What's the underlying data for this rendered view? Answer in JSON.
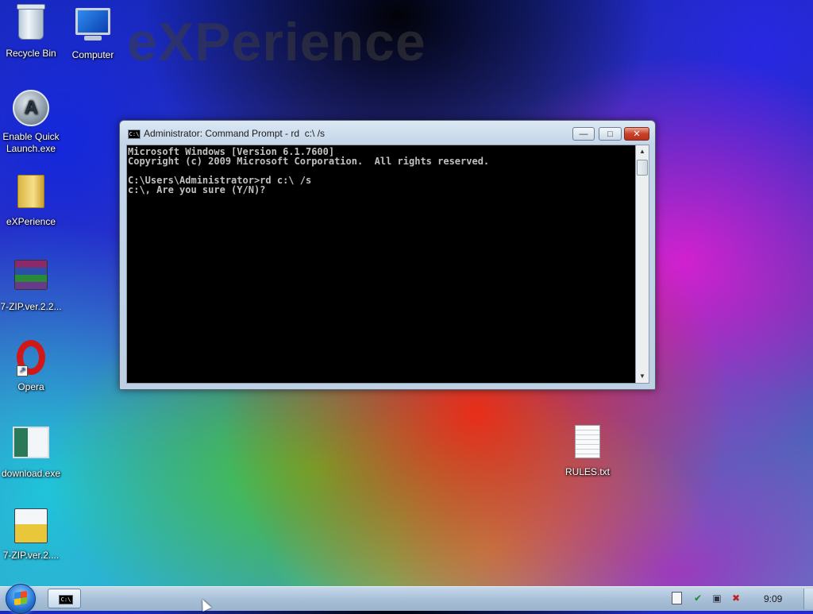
{
  "wallpaper": {
    "watermark": "eXPerience"
  },
  "desktop": {
    "icons": [
      {
        "label": "Recycle Bin",
        "icon": "recycle-bin-icon"
      },
      {
        "label": "Computer",
        "icon": "computer-icon"
      },
      {
        "label": "Enable Quick Launch.exe",
        "icon": "quick-launch-icon"
      },
      {
        "label": "eXPerience",
        "icon": "folder-icon"
      },
      {
        "label": "7-ZIP.ver.2.2...",
        "icon": "archive-icon"
      },
      {
        "label": "Opera",
        "icon": "opera-icon"
      },
      {
        "label": "download.exe",
        "icon": "download-exe-icon"
      },
      {
        "label": "7-ZIP.ver.2....",
        "icon": "installer-icon"
      },
      {
        "label": "RULES.txt",
        "icon": "text-file-icon"
      }
    ]
  },
  "cmd_window": {
    "title": "Administrator: Command Prompt - rd  c:\\ /s",
    "controls": {
      "minimize": "—",
      "maximize": "□",
      "close": "✕"
    },
    "icon_text": "C:\\",
    "console_lines": [
      "Microsoft Windows [Version 6.1.7600]",
      "Copyright (c) 2009 Microsoft Corporation.  All rights reserved.",
      "",
      "C:\\Users\\Administrator>rd c:\\ /s",
      "c:\\, Are you sure (Y/N)?"
    ]
  },
  "taskbar": {
    "clock": "9:09",
    "task_buttons": [
      {
        "icon": "command-prompt-icon",
        "icon_text": "C:\\"
      }
    ],
    "tray_icons": [
      "action-center-icon",
      "security-icon",
      "network-icon",
      "volume-muted-icon"
    ]
  }
}
